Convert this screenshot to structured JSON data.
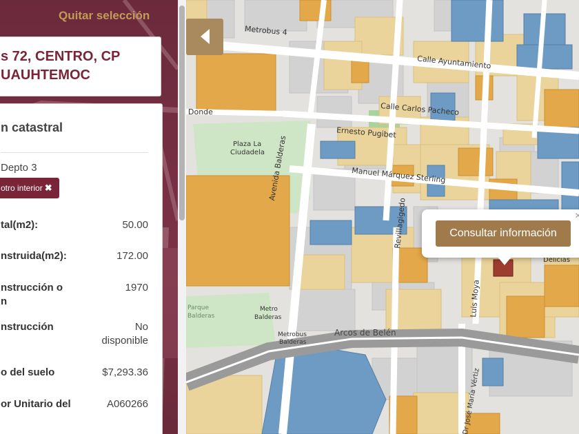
{
  "panel": {
    "clear_selection": "Quitar selección",
    "address_line1": "s 72, CENTRO, CP",
    "address_line2": "UAUHTEMOC",
    "info_title": "n catastral",
    "unit": "Depto 3",
    "filter_tag": "otro interior",
    "rows": [
      {
        "label": "tal(m2):",
        "value": "50.00"
      },
      {
        "label": "nstruida(m2):",
        "value": "172.00"
      },
      {
        "label_line1": "nstrucción o",
        "label_line2": "n",
        "value": "1970"
      },
      {
        "label": "nstrucción",
        "value_line1": "No",
        "value_line2": "disponible"
      },
      {
        "label": "o del suelo",
        "value": "$7,293.36"
      },
      {
        "label": "or Unitario del",
        "value": "A060266"
      }
    ]
  },
  "map": {
    "popup_button": "Consultar información",
    "popup_close": "×",
    "labels": {
      "metrobus4": "Metrobus 4",
      "ayuntamiento": "Calle Ayuntamiento",
      "carlos_pacheco": "Calle Carlos Pacheco",
      "ernesto": "Ernesto Pugibet",
      "marquez": "Manuel Márquez Sterling",
      "donde": "Donde",
      "plaza": "Plaza La",
      "ciudadela": "Ciudadela",
      "balderas": "Avenida Balderas",
      "revillagigedo": "Revillagigedo",
      "luismoya": "Luis Moya",
      "parque": "Parque",
      "parque2": "Balderas",
      "metro": "Metro",
      "metro2": "Balderas",
      "metrobus": "Metrobus",
      "metrobus2": "Balderas",
      "arcos": "Arcos de Belén",
      "jose_maria": "Dr José María Vértiz",
      "delicias": "Delicias",
      "emilio": "Emi"
    }
  },
  "colors": {
    "maroon": "#7a2437",
    "gold": "#c49a57",
    "orange_block": "#e3a84a",
    "tan_block": "#ead49b",
    "blue_block": "#6d9bc3",
    "gray_block": "#d2d2d2",
    "park": "#cfe6c6"
  }
}
